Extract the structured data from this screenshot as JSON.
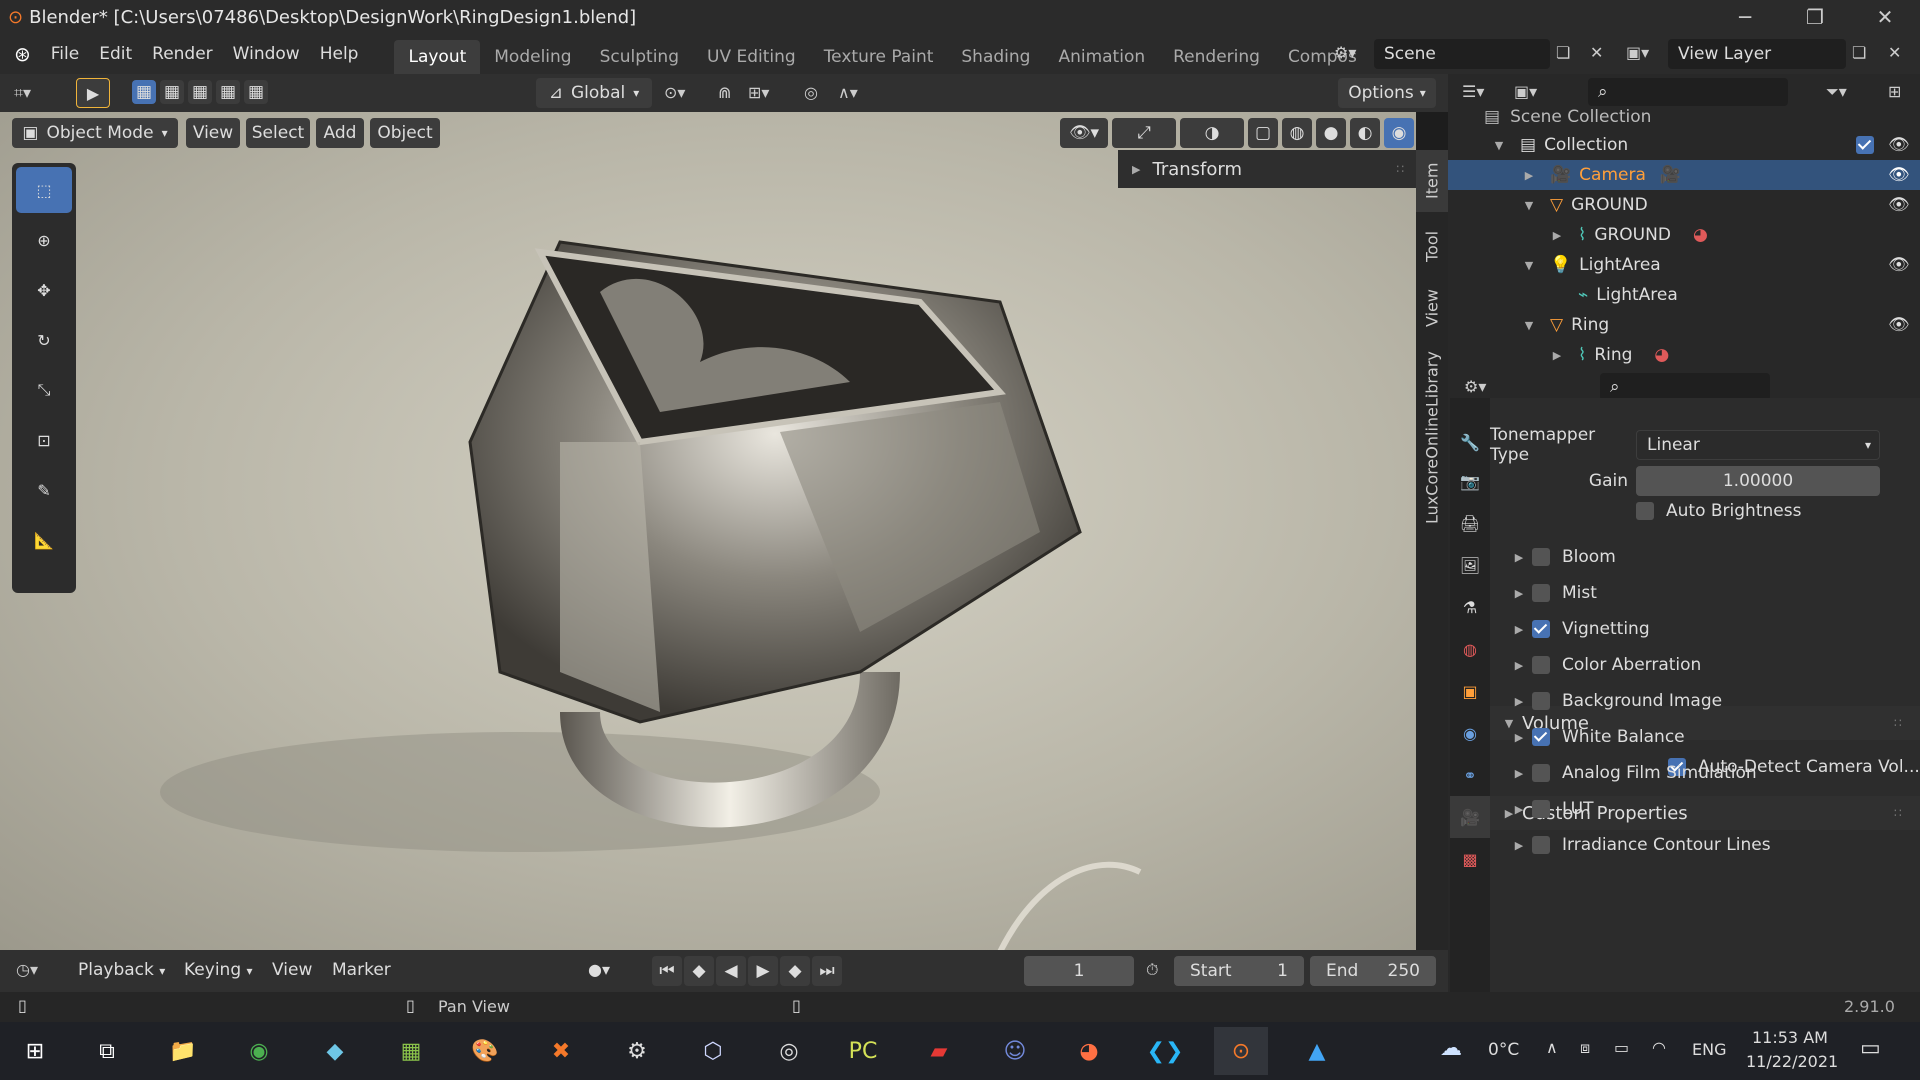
{
  "window": {
    "title": "Blender* [C:\\Users\\07486\\Desktop\\DesignWork\\RingDesign1.blend]"
  },
  "menus": [
    "File",
    "Edit",
    "Render",
    "Window",
    "Help"
  ],
  "workspaces": [
    "Layout",
    "Modeling",
    "Sculpting",
    "UV Editing",
    "Texture Paint",
    "Shading",
    "Animation",
    "Rendering",
    "Compos"
  ],
  "scene": {
    "name": "Scene",
    "view_layer": "View Layer"
  },
  "header": {
    "orientation": "Global",
    "options": "Options"
  },
  "viewport_header": {
    "mode": "Object Mode",
    "view": "View",
    "select": "Select",
    "add": "Add",
    "object": "Object"
  },
  "npanel": {
    "transform": "Transform",
    "tabs": [
      "Item",
      "Tool",
      "View",
      "LuxCoreOnlineLibrary"
    ]
  },
  "outliner": {
    "scene_collection": "Scene Collection",
    "items": [
      {
        "name": "Collection"
      },
      {
        "name": "Camera"
      },
      {
        "name": "GROUND"
      },
      {
        "name": "GROUND"
      },
      {
        "name": "LightArea"
      },
      {
        "name": "LightArea"
      },
      {
        "name": "Ring"
      },
      {
        "name": "Ring"
      }
    ]
  },
  "properties": {
    "tonemapper_label": "Tonemapper Type",
    "tonemapper_value": "Linear",
    "gain_label": "Gain",
    "gain_value": "1.00000",
    "auto_brightness": "Auto Brightness",
    "effects": [
      {
        "label": "Bloom",
        "checked": false
      },
      {
        "label": "Mist",
        "checked": false
      },
      {
        "label": "Vignetting",
        "checked": true
      },
      {
        "label": "Color Aberration",
        "checked": false
      },
      {
        "label": "Background Image",
        "checked": false
      },
      {
        "label": "White Balance",
        "checked": true
      },
      {
        "label": "Analog Film Simulation",
        "checked": false
      },
      {
        "label": "LUT",
        "checked": false
      },
      {
        "label": "Irradiance Contour Lines",
        "checked": false
      }
    ],
    "volume": "Volume",
    "auto_detect": "Auto-Detect Camera Vol...",
    "custom_props": "Custom Properties"
  },
  "timeline": {
    "playback": "Playback",
    "keying": "Keying",
    "view": "View",
    "marker": "Marker",
    "frame": "1",
    "start_label": "Start",
    "start": "1",
    "end_label": "End",
    "end": "250"
  },
  "status": {
    "hint": "Pan View",
    "version": "2.91.0"
  },
  "taskbar": {
    "temp": "0°C",
    "lang": "ENG",
    "time": "11:53 AM",
    "date": "11/22/2021"
  },
  "colors": {
    "accent": "#4772b3",
    "selected_text": "#ff9f3a",
    "bg": "#282828"
  }
}
